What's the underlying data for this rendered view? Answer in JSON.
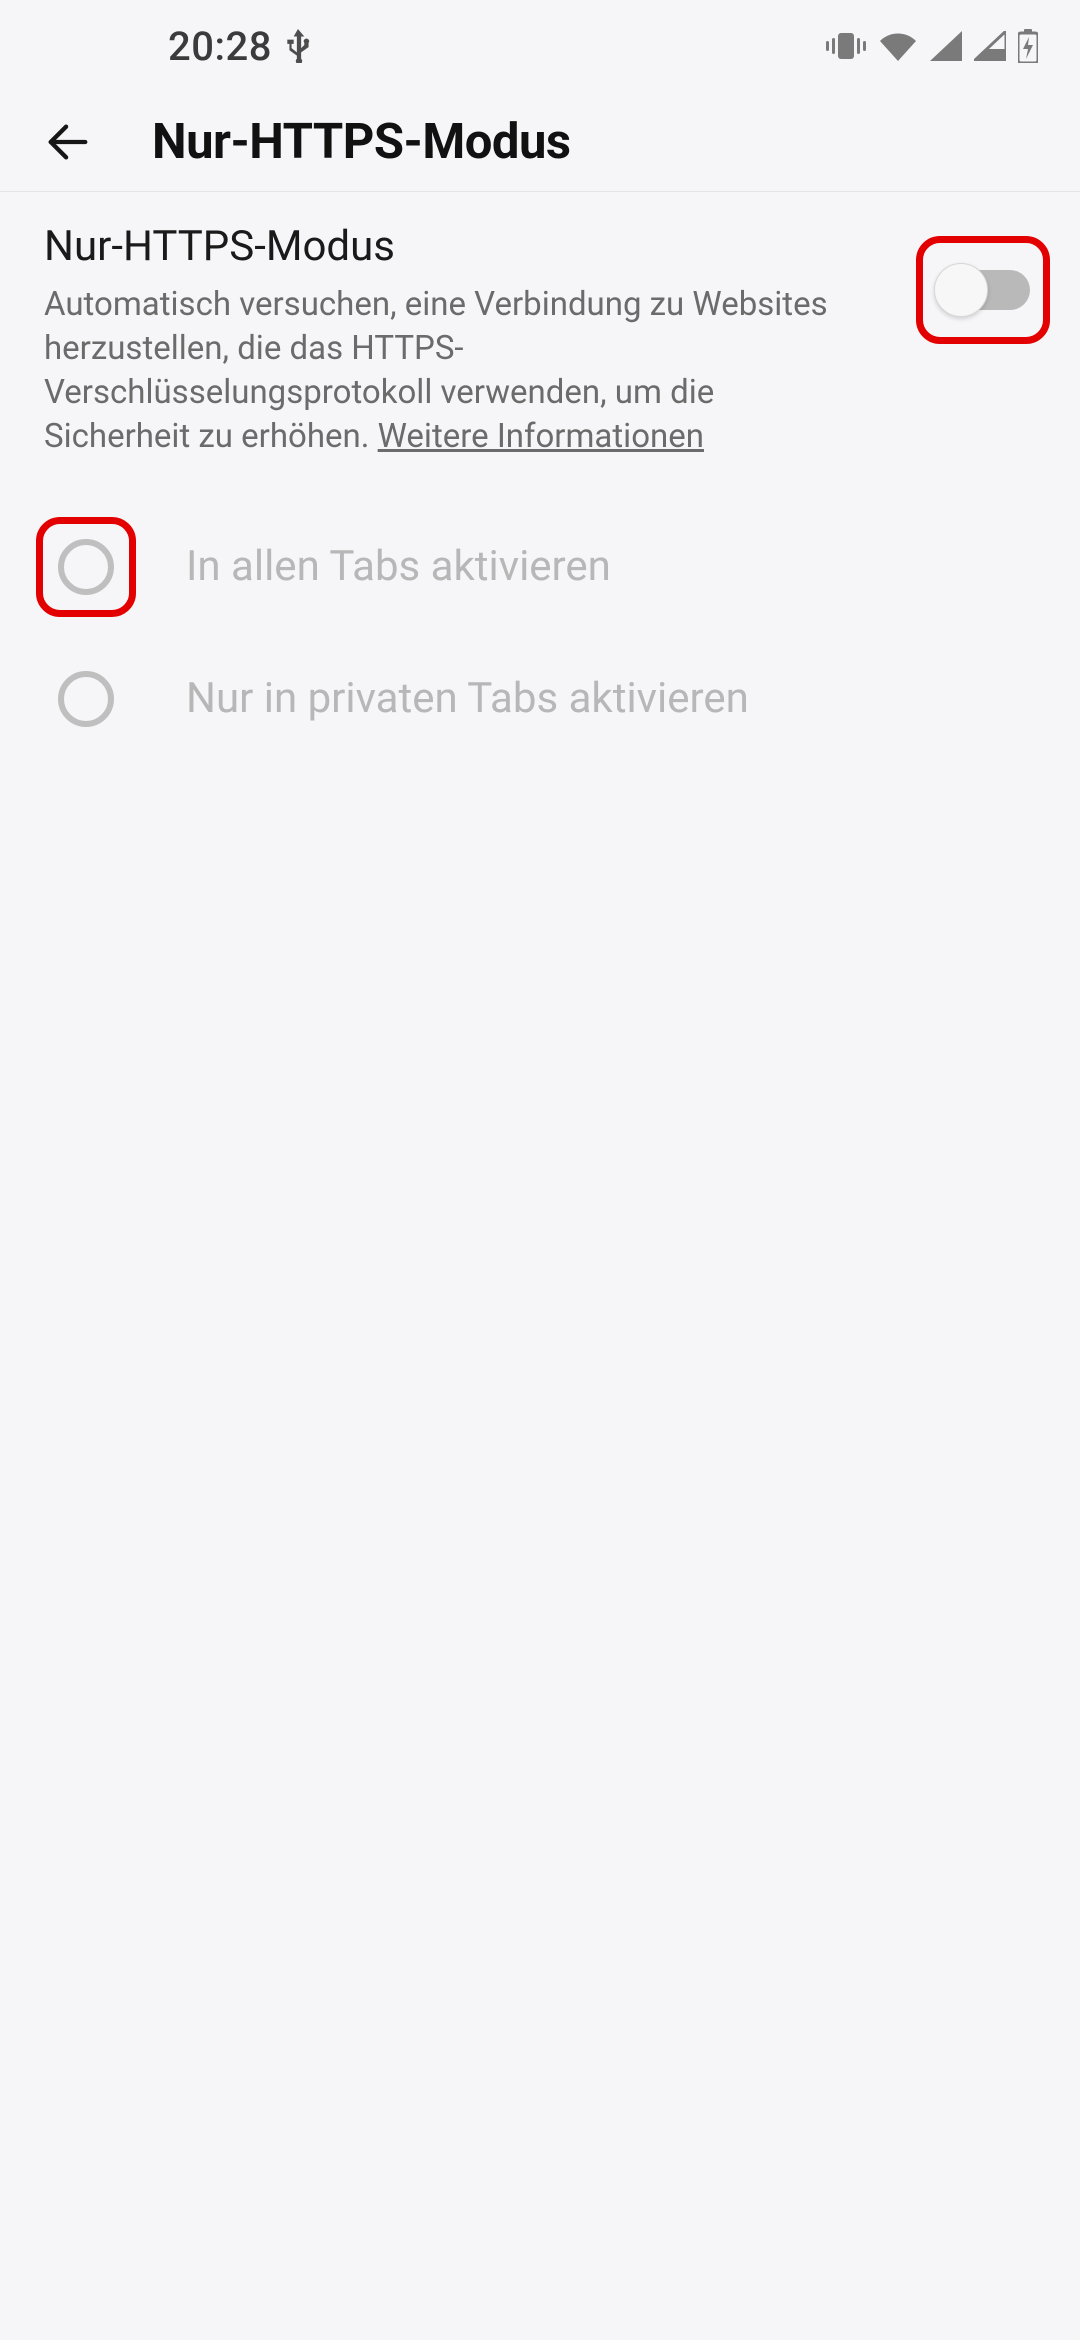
{
  "status_bar": {
    "time": "20:28"
  },
  "app_bar": {
    "title": "Nur-HTTPS-Modus"
  },
  "setting": {
    "title": "Nur-HTTPS-Modus",
    "description_prefix": "Automatisch versuchen, eine Verbindung zu Websites herzustellen, die das HTTPS-Verschlüsselungsprotokoll verwenden, um die Sicherheit zu erhöhen. ",
    "more_info": "Weitere Informationen",
    "toggle_on": false
  },
  "options": [
    {
      "label": "In allen Tabs aktivieren",
      "selected": false,
      "highlighted": true
    },
    {
      "label": "Nur in privaten Tabs aktivieren",
      "selected": false,
      "highlighted": false
    }
  ],
  "highlights": {
    "toggle": true
  }
}
